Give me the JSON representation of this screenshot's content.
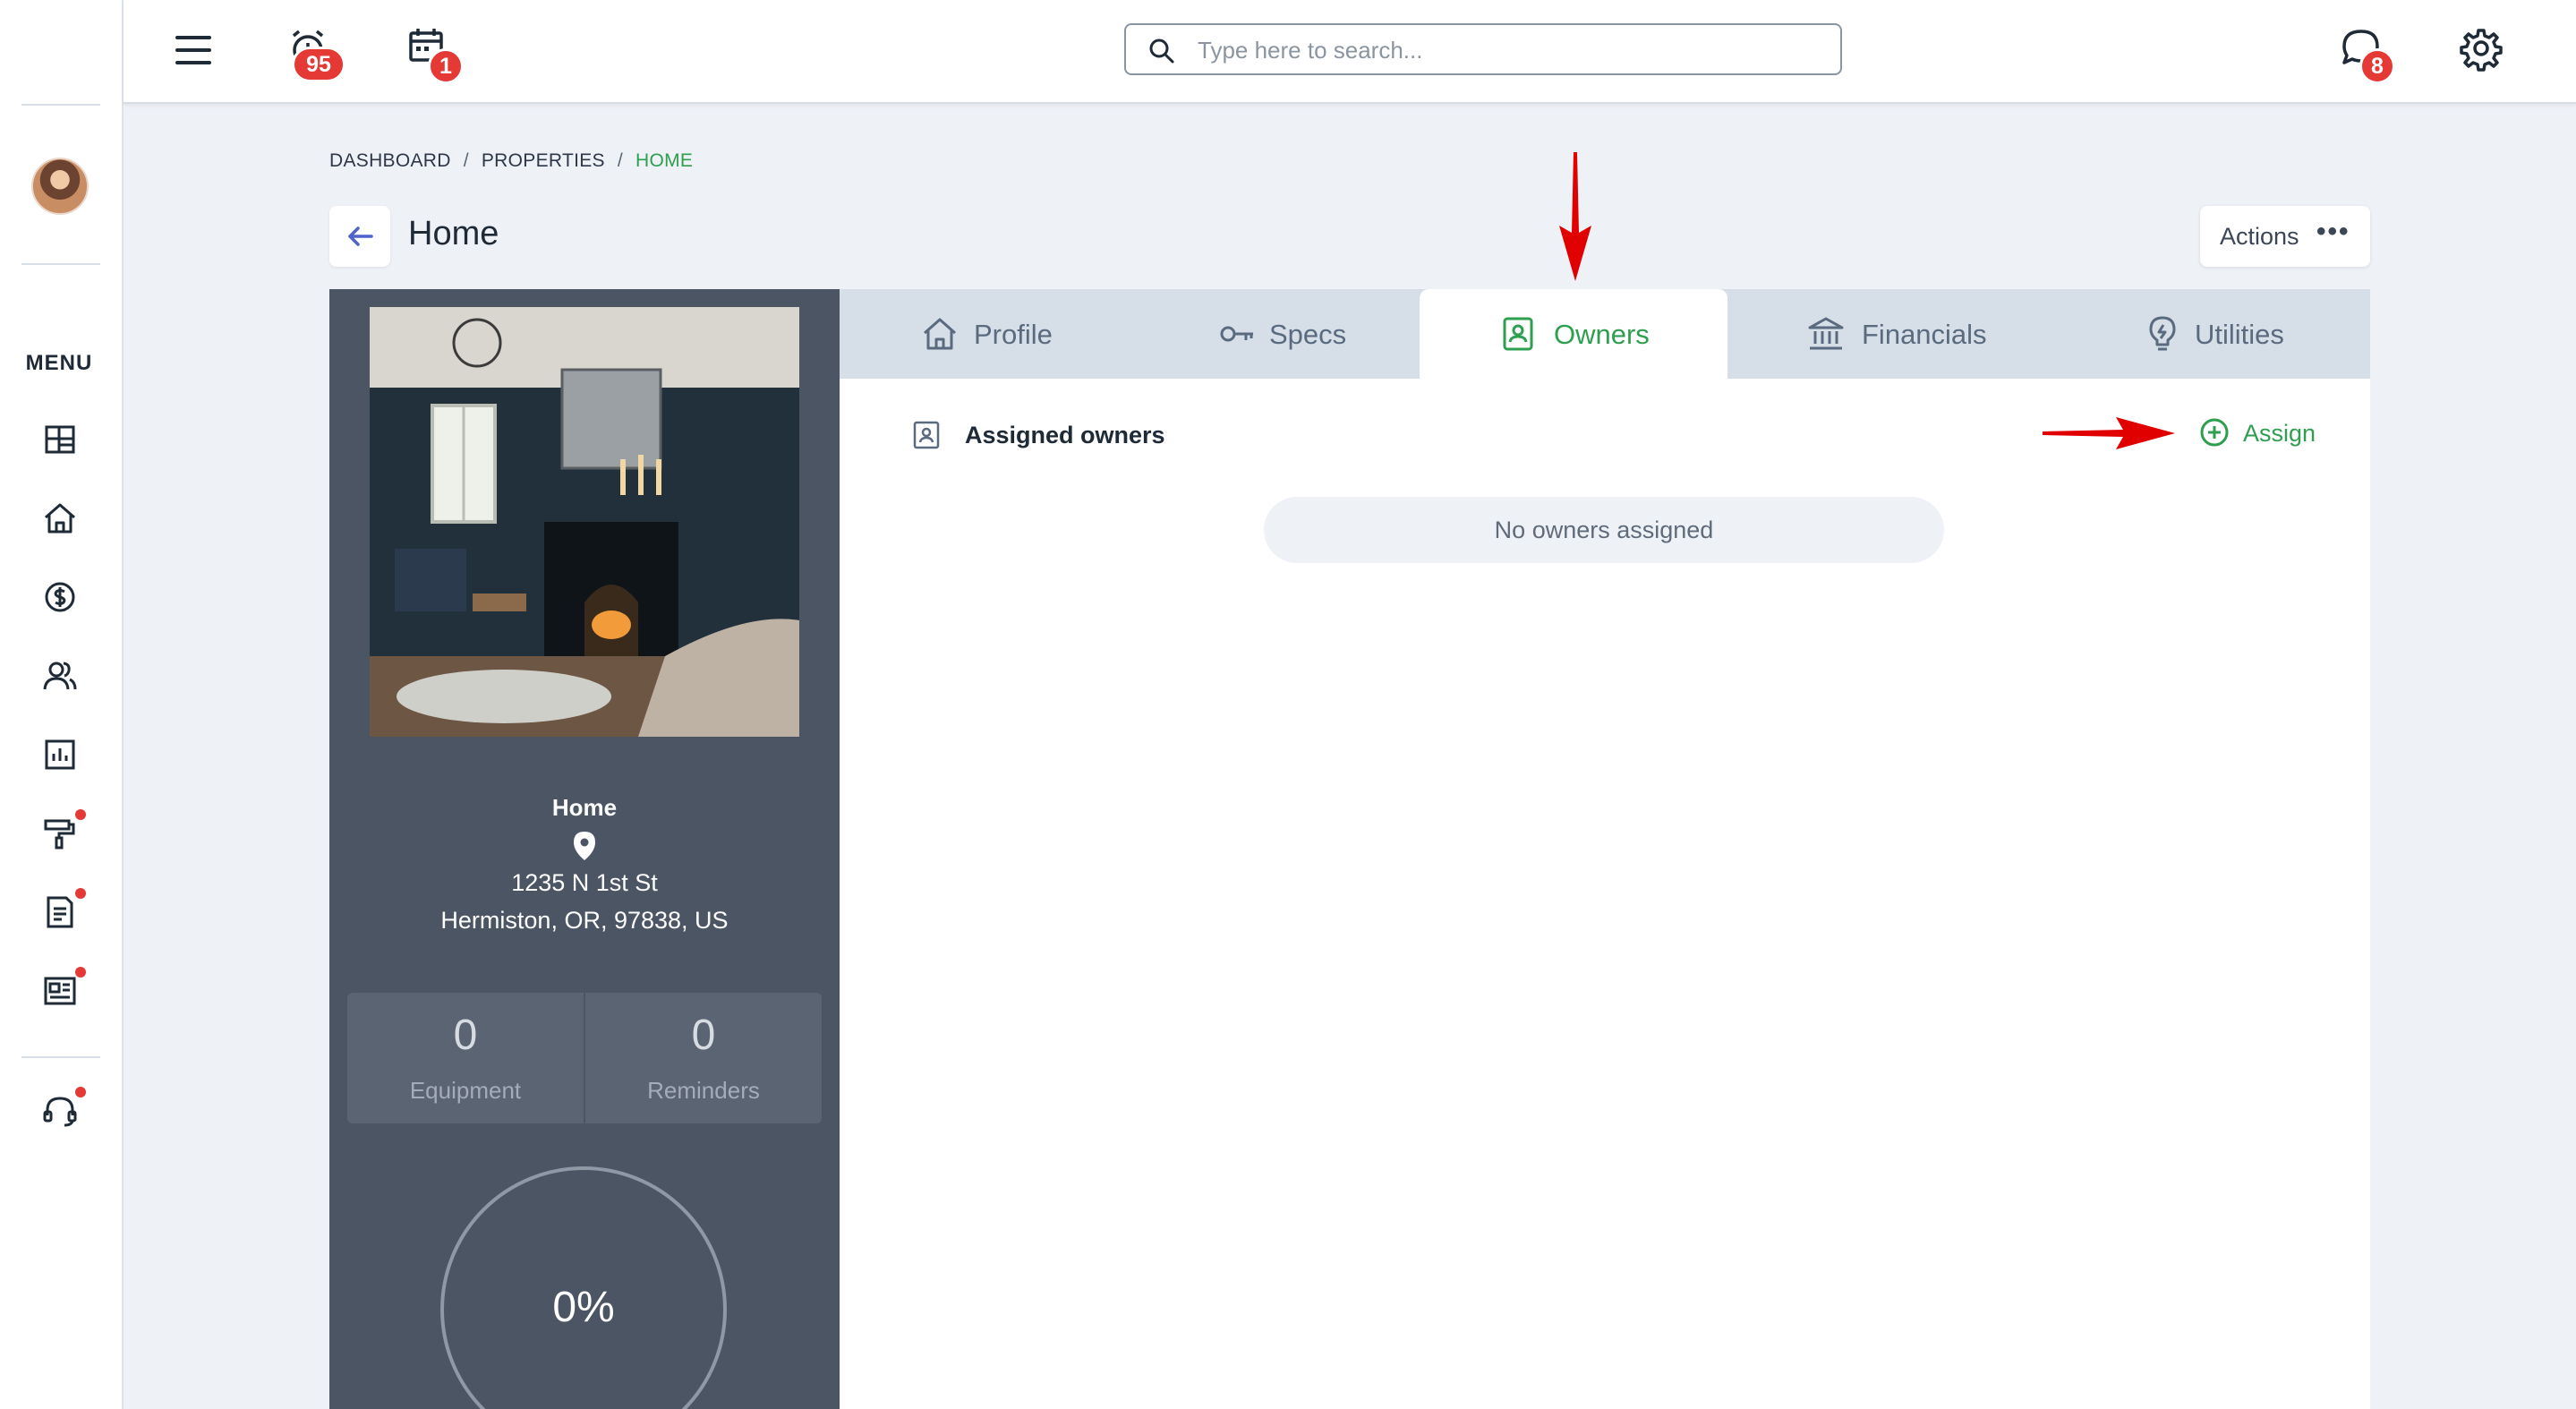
{
  "topbar": {
    "alarm_badge": "95",
    "calendar_badge": "1",
    "search_placeholder": "Type here to search...",
    "chat_badge": "8"
  },
  "sidebar": {
    "menu_label": "MENU",
    "items": [
      {
        "icon": "dashboard-icon",
        "notification": false
      },
      {
        "icon": "home-icon",
        "notification": false
      },
      {
        "icon": "dollar-icon",
        "notification": false
      },
      {
        "icon": "users-icon",
        "notification": false
      },
      {
        "icon": "chart-icon",
        "notification": false
      },
      {
        "icon": "paint-roller-icon",
        "notification": true
      },
      {
        "icon": "document-icon",
        "notification": true
      },
      {
        "icon": "newspaper-icon",
        "notification": true
      }
    ],
    "support_icon": "headset-icon",
    "support_notification": true
  },
  "breadcrumb": {
    "items": [
      "DASHBOARD",
      "PROPERTIES",
      "HOME"
    ],
    "separator": "/",
    "active_color": "#2e9e4f"
  },
  "page": {
    "title": "Home",
    "actions_label": "Actions"
  },
  "property": {
    "name": "Home",
    "address_line1": "1235 N 1st St",
    "address_line2": "Hermiston, OR, 97838, US",
    "equipment_count": "0",
    "equipment_label": "Equipment",
    "reminders_count": "0",
    "reminders_label": "Reminders",
    "progress_text": "0%",
    "progress_value": 0
  },
  "tabs": [
    {
      "label": "Profile",
      "icon": "house-icon",
      "active": false
    },
    {
      "label": "Specs",
      "icon": "key-icon",
      "active": false
    },
    {
      "label": "Owners",
      "icon": "owner-badge-icon",
      "active": true
    },
    {
      "label": "Financials",
      "icon": "bank-icon",
      "active": false
    },
    {
      "label": "Utilities",
      "icon": "lightbulb-icon",
      "active": false
    }
  ],
  "owners": {
    "section_title": "Assigned owners",
    "assign_label": "Assign",
    "empty_message": "No owners assigned"
  },
  "colors": {
    "accent_green": "#2e9e4f",
    "badge_red": "#e53935",
    "card_dark": "#4b5563",
    "annotation_red": "#e00000"
  }
}
